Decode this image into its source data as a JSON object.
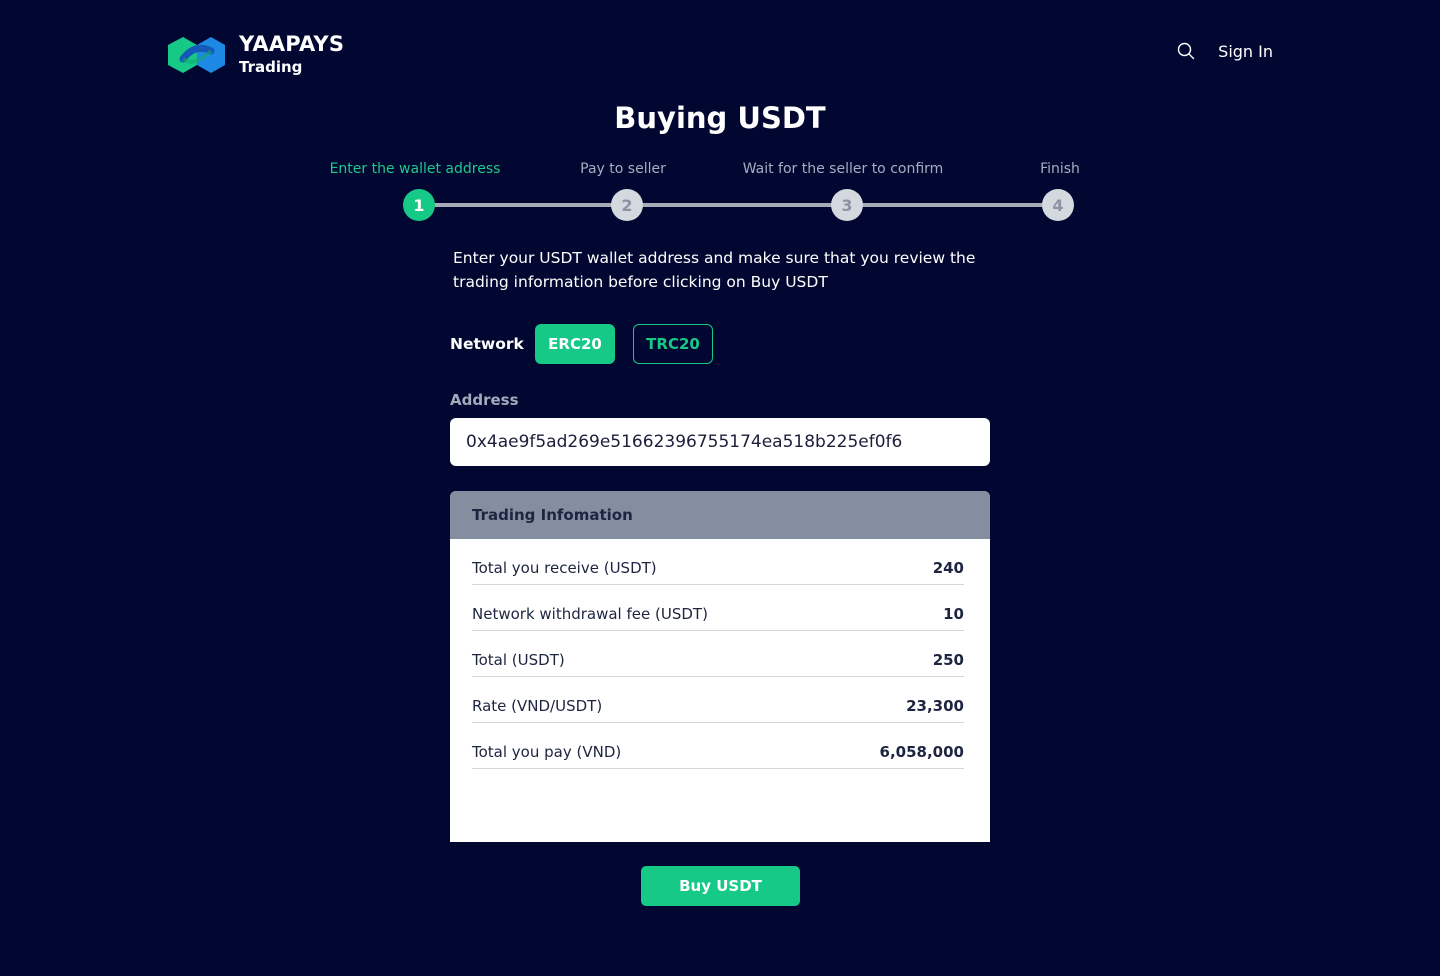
{
  "header": {
    "brand_name": "YAAPAYS",
    "brand_sub": "Trading",
    "logo_icon": "hexagon-logo-icon",
    "search_icon": "search-icon",
    "sign_in": "Sign In"
  },
  "page_title": "Buying USDT",
  "stepper": {
    "steps": [
      {
        "label": "Enter the wallet address",
        "number": "1",
        "active": true
      },
      {
        "label": "Pay to seller",
        "number": "2",
        "active": false
      },
      {
        "label": "Wait for the seller to confirm",
        "number": "3",
        "active": false
      },
      {
        "label": "Finish",
        "number": "4",
        "active": false
      }
    ]
  },
  "instructions": "Enter your USDT wallet address and make sure that you review the trading information before clicking on Buy USDT",
  "network": {
    "label": "Network",
    "options": [
      "ERC20",
      "TRC20"
    ],
    "selected": "ERC20"
  },
  "address": {
    "label": "Address",
    "value": "0x4ae9f5ad269e51662396755174ea518b225ef0f6"
  },
  "trading_info": {
    "title": "Trading Infomation",
    "rows": [
      {
        "label": "Total you receive (USDT)",
        "value": "240"
      },
      {
        "label": "Network withdrawal fee (USDT)",
        "value": "10"
      },
      {
        "label": "Total (USDT)",
        "value": "250"
      },
      {
        "label": "Rate (VND/USDT)",
        "value": "23,300"
      },
      {
        "label": "Total you pay (VND)",
        "value": "6,058,000"
      }
    ]
  },
  "buy_button": "Buy USDT",
  "colors": {
    "background": "#020731",
    "accent": "#17c987",
    "info_header": "#848e9f"
  }
}
